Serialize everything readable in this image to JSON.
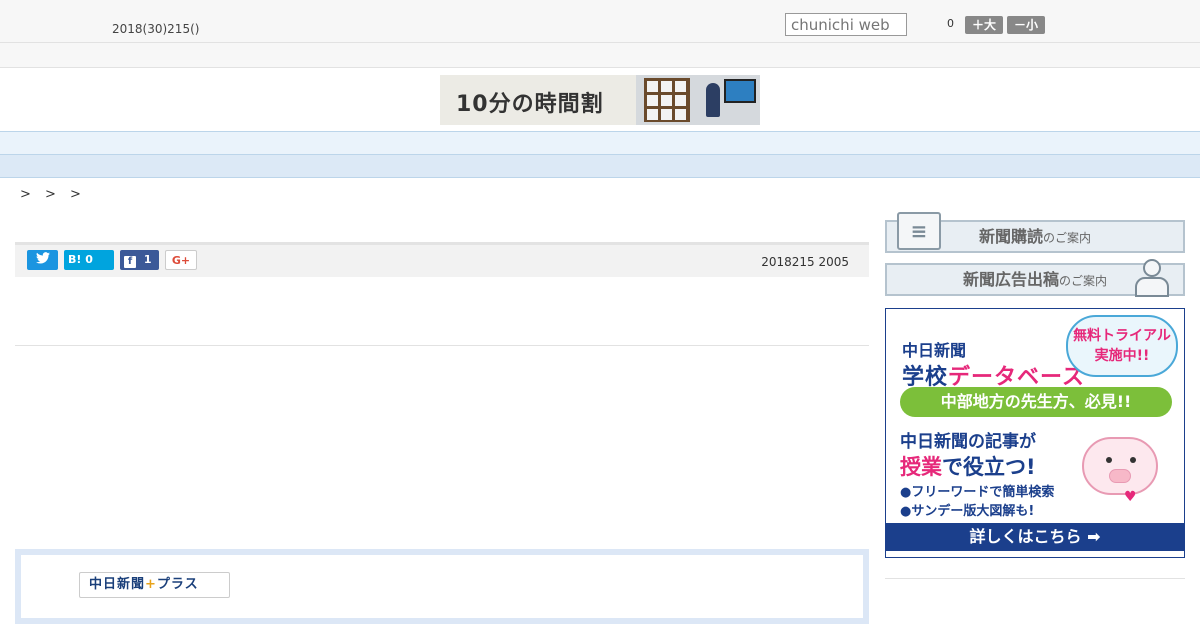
{
  "header": {
    "date": "2018(30)215()",
    "search_placeholder": "chunichi web",
    "count": "0",
    "font_large_label": "＋大",
    "font_small_label": "－小"
  },
  "banner": {
    "text": "10分の時間割"
  },
  "nav": {
    "items": [
      "",
      "",
      "",
      "",
      "",
      "",
      "",
      "",
      ""
    ]
  },
  "breadcrumb": {
    "text": "> > >"
  },
  "share": {
    "twitter_icon": "twitter-icon",
    "hatena_label": "B!",
    "hatena_count": "0",
    "facebook_count": "1",
    "gplus_label": "G+",
    "publish_date": "2018215 2005"
  },
  "plus": {
    "logo_text_a": "中日新聞",
    "logo_plus": "+",
    "logo_text_b": "プラス"
  },
  "sidebar": {
    "subscribe_main": "新聞購読",
    "subscribe_tail": "のご案内",
    "ad_main": "新聞広告出稿",
    "ad_tail": "のご案内",
    "db_ad": {
      "paper_name": "中日新聞",
      "db_title_a": "学校",
      "db_title_b": "データベース",
      "trial_l1": "無料トライアル",
      "trial_l2": "実施中!!",
      "green_text": "中部地方の先生方、必見!!",
      "line1": "中日新聞の記事が",
      "line2_a": "授業",
      "line2_b": "で役立つ!",
      "bullet1": "●フリーワードで簡単検索",
      "bullet2": "●サンデー版大図解も!",
      "heart": "♥",
      "detail": "詳しくはこちら ➡"
    }
  },
  "colors": {
    "nav_bg": "#eaf3fb",
    "brand_blue": "#1b3f8c",
    "accent_pink": "#e6287a",
    "twitter": "#1b95e0",
    "hatena": "#00a4de",
    "facebook": "#3b5998"
  }
}
